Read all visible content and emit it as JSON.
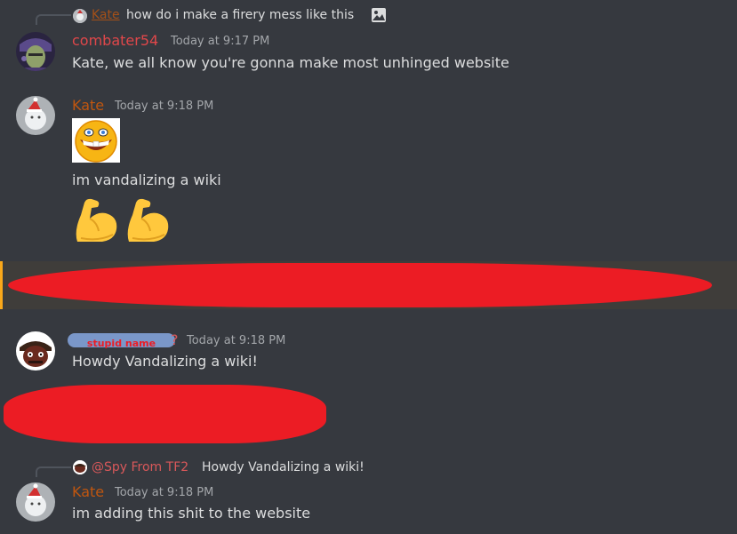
{
  "colors": {
    "background": "#36393f",
    "kate": "#c0560f",
    "combater": "#e0474a",
    "spy_mention": "#d9585a",
    "redaction": "#ec1c24",
    "highlight_bar": "#faa81a",
    "overlay_label_bg": "#7a97c9"
  },
  "reply1": {
    "username": "Kate",
    "text": "how do i make a firery mess like this",
    "icon": "image-icon"
  },
  "msg1": {
    "username": "combater54",
    "timestamp": "Today at 9:17 PM",
    "text": "Kate, we all know you're gonna make most unhinged website"
  },
  "msg2": {
    "username": "Kate",
    "timestamp": "Today at 9:18 PM",
    "text": "im vandalizing a wiki",
    "emoji_image": "grinning-face-sticker",
    "emojis": [
      "flexed-biceps-icon",
      "flexed-biceps-icon"
    ]
  },
  "msg3": {
    "username_overlay": "stupid name",
    "username_suffix": "?",
    "timestamp": "Today at 9:18 PM",
    "text": "Howdy Vandalizing a wiki!"
  },
  "reply2": {
    "mention": "@Spy From TF2",
    "text": "Howdy Vandalizing a wiki!"
  },
  "msg4": {
    "username": "Kate",
    "timestamp": "Today at 9:18 PM",
    "text": "im adding this shit to the website"
  }
}
